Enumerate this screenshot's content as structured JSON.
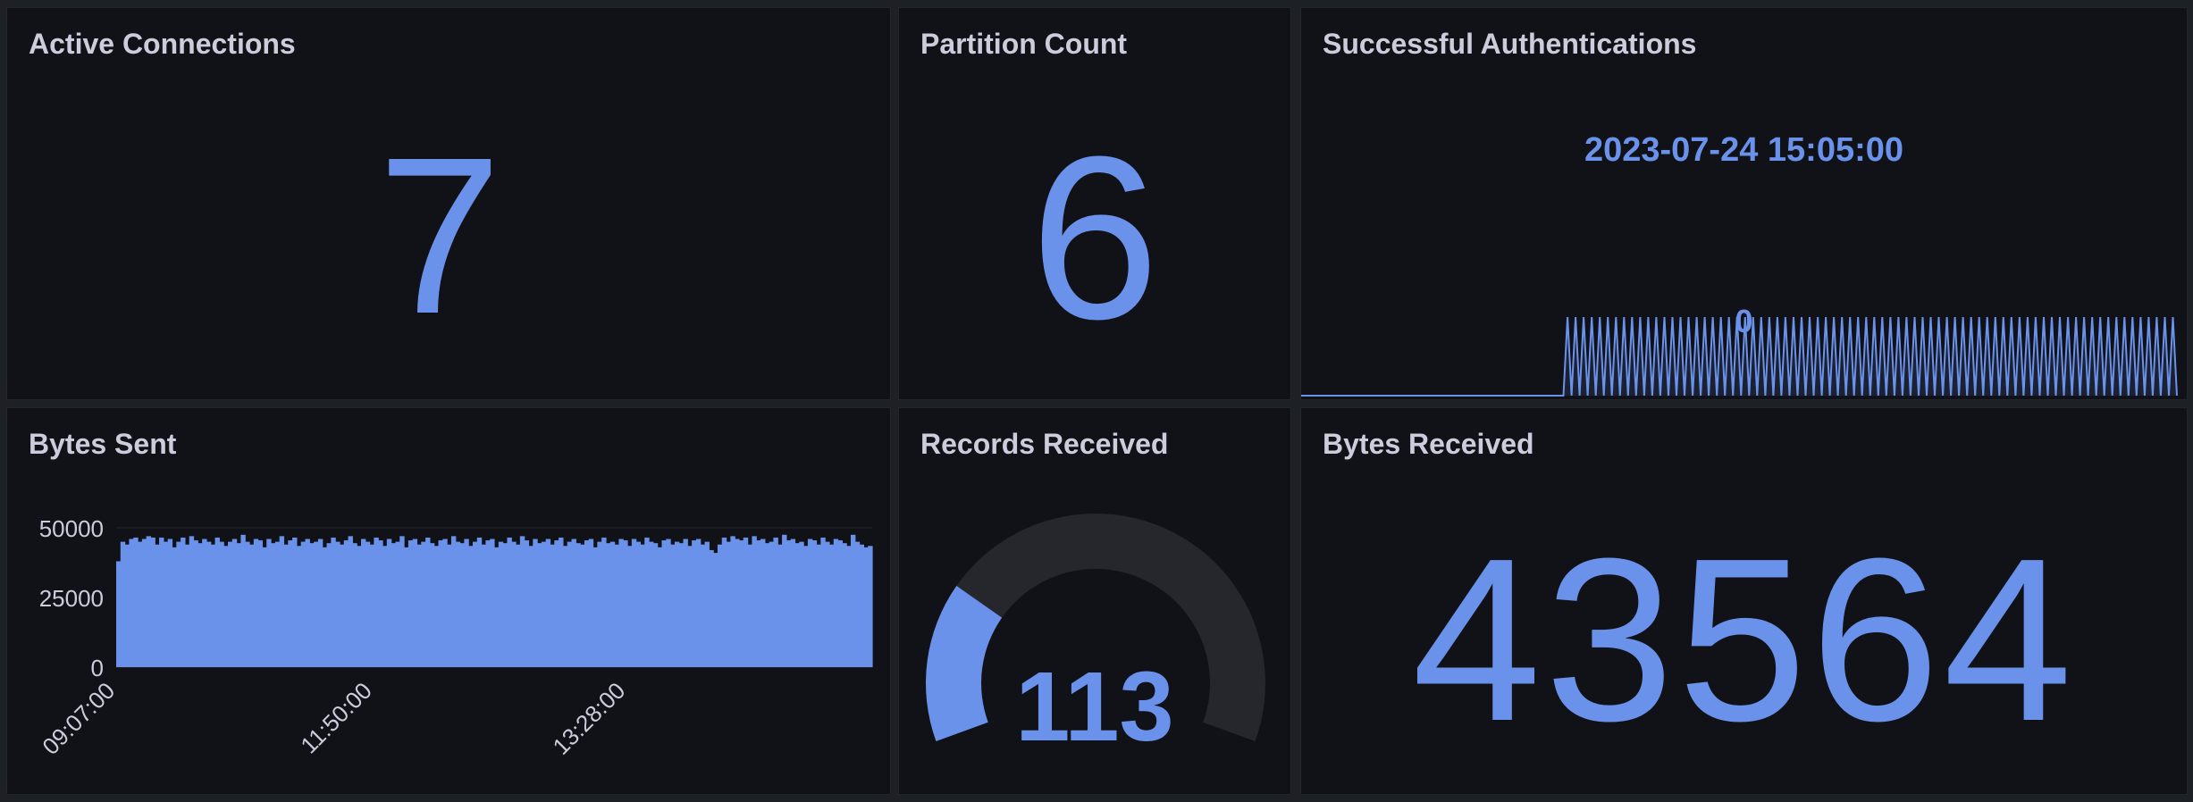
{
  "colors": {
    "accent": "#6b92ea",
    "panel_bg": "#111217",
    "page_bg": "#1d2125",
    "title": "#ccccdc",
    "axis": "#ccccdc",
    "gauge_track": "#25272c"
  },
  "active_connections": {
    "title": "Active Connections",
    "value": "7"
  },
  "partition_count": {
    "title": "Partition Count",
    "value": "6"
  },
  "successful_auth": {
    "title": "Successful Authentications",
    "timestamp": "2023-07-24 15:05:00",
    "value": "0"
  },
  "bytes_sent": {
    "title": "Bytes Sent"
  },
  "records_received": {
    "title": "Records Received",
    "value": "113",
    "fraction": 0.25
  },
  "bytes_received": {
    "title": "Bytes Received",
    "value": "43564"
  },
  "chart_data": [
    {
      "type": "bar",
      "title": "Bytes Sent",
      "yticks": [
        "0",
        "25000",
        "50000"
      ],
      "ylim": [
        0,
        50000
      ],
      "xticks": [
        "09:07:00",
        "11:50:00",
        "13:28:00"
      ],
      "grid": true,
      "values": [
        38000,
        45000,
        44000,
        46000,
        46500,
        45000,
        46000,
        47000,
        46500,
        44000,
        46500,
        45000,
        46000,
        43000,
        45000,
        46500,
        44000,
        47000,
        45500,
        44500,
        46000,
        45000,
        44000,
        46500,
        45000,
        43500,
        45000,
        46000,
        44500,
        47500,
        45000,
        44000,
        46000,
        45500,
        43000,
        46000,
        44500,
        45000,
        47000,
        44000,
        45500,
        46500,
        43500,
        45000,
        46000,
        44500,
        45000,
        46000,
        43000,
        44500,
        46500,
        45000,
        44000,
        45500,
        47000,
        44500,
        43500,
        46000,
        45000,
        44000,
        46500,
        45500,
        43500,
        46000,
        44500,
        45000,
        47000,
        43000,
        45500,
        46000,
        44000,
        45000,
        46500,
        44500,
        43500,
        45500,
        46000,
        44000,
        47000,
        45000,
        44500,
        46000,
        43500,
        45000,
        46500,
        44000,
        45500,
        46000,
        43000,
        45000,
        44500,
        46500,
        45000,
        44000,
        47000,
        45500,
        43500,
        46000,
        44500,
        45000,
        46000,
        44000,
        45500,
        46500,
        43500,
        45000,
        46000,
        44500,
        44000,
        45500,
        46000,
        43000,
        45000,
        46500,
        44500,
        45000,
        44000,
        46000,
        45500,
        43500,
        46000,
        45000,
        44000,
        46500,
        45000,
        44500,
        43000,
        45500,
        46000,
        44000,
        45000,
        44500,
        46000,
        43500,
        45500,
        46000,
        44000,
        45000,
        42000,
        41000,
        44000,
        46500,
        45000,
        47000,
        46000,
        45500,
        46500,
        44000,
        47000,
        45500,
        46000,
        44500,
        45000,
        46500,
        44000,
        47500,
        45500,
        46000,
        44500,
        45000,
        43500,
        46000,
        45500,
        44000,
        46500,
        45000,
        44000,
        46000,
        45500,
        44500,
        43500,
        47500,
        45000,
        44000,
        43000,
        43500
      ]
    },
    {
      "type": "line",
      "title": "Successful Authentications",
      "ylim": [
        0,
        1
      ],
      "values": [
        0,
        0,
        0,
        0,
        0,
        0,
        0,
        0,
        0,
        0,
        0,
        0,
        0,
        0,
        0,
        0,
        0,
        0,
        0,
        0,
        0,
        0,
        0,
        0,
        0,
        0,
        0,
        0,
        0,
        0,
        0,
        0,
        0,
        0,
        0,
        0,
        0,
        0,
        0,
        0,
        0,
        0,
        0,
        0,
        0,
        0,
        0,
        0,
        0,
        0,
        0,
        0,
        0,
        0,
        0,
        0,
        0,
        0,
        0,
        0,
        0,
        0,
        0,
        0,
        0,
        0,
        1,
        0,
        1,
        0,
        1,
        0,
        1,
        0,
        1,
        0,
        1,
        0,
        1,
        0,
        1,
        0,
        1,
        0,
        1,
        0,
        1,
        0,
        1,
        0,
        1,
        0,
        1,
        0,
        1,
        0,
        1,
        0,
        1,
        0,
        1,
        0,
        1,
        0,
        1,
        0,
        1,
        0,
        1,
        0,
        1,
        0,
        1,
        0,
        1,
        0,
        1,
        0,
        1,
        0,
        1,
        0,
        1,
        0,
        1,
        0,
        1,
        0,
        1,
        0,
        1,
        0,
        1,
        0,
        1,
        0,
        1,
        0,
        1,
        0,
        1,
        0,
        1,
        0,
        1,
        0,
        1,
        0,
        1,
        0,
        1,
        0,
        1,
        0,
        1,
        0,
        1,
        0,
        1,
        0,
        1,
        0,
        1,
        0,
        1,
        0,
        1,
        0,
        1,
        0,
        1,
        0,
        1,
        0,
        1,
        0,
        1,
        0,
        1,
        0,
        1,
        0,
        1,
        0,
        1,
        0,
        1,
        0,
        1,
        0,
        1,
        0,
        1,
        0,
        1,
        0,
        1,
        0,
        1,
        0,
        1,
        0,
        1,
        0,
        1,
        0,
        1,
        0,
        1,
        0,
        1,
        0,
        1,
        0,
        1,
        0,
        1,
        0
      ]
    }
  ]
}
